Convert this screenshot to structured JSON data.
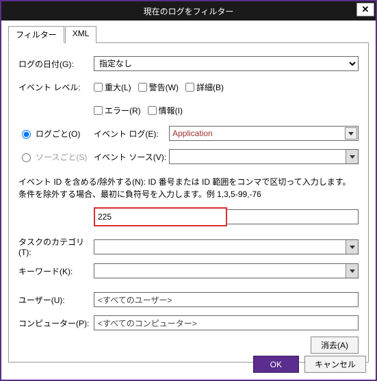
{
  "title": "現在のログをフィルター",
  "close_x": "✕",
  "tabs": {
    "filter": "フィルター",
    "xml": "XML"
  },
  "labels": {
    "logged": "ログの日付(G):",
    "level": "イベント レベル:",
    "bylog": "ログごと(O)",
    "bysource": "ソースごと(S)",
    "eventlog": "イベント ログ(E):",
    "eventsource": "イベント ソース(V):",
    "task": "タスクのカテゴリ(T):",
    "keyword": "キーワード(K):",
    "user": "ユーザー(U):",
    "computer": "コンピューター(P):"
  },
  "logged_value": "指定なし",
  "levels": {
    "critical": "重大(L)",
    "warning": "警告(W)",
    "verbose": "詳細(B)",
    "error": "エラー(R)",
    "info": "情報(I)"
  },
  "eventlog_value": "Application",
  "instruction": "イベント ID を含める/除外する(N): ID 番号または ID 範囲をコンマで区切って入力します。条件を除外する場合、最初に負符号を入力します。例 1,3,5-99,-76",
  "event_id_value": "225",
  "user_value": "<すべてのユーザー>",
  "computer_value": "<すべてのコンピューター>",
  "buttons": {
    "clear": "消去(A)",
    "ok": "OK",
    "cancel": "キャンセル"
  }
}
